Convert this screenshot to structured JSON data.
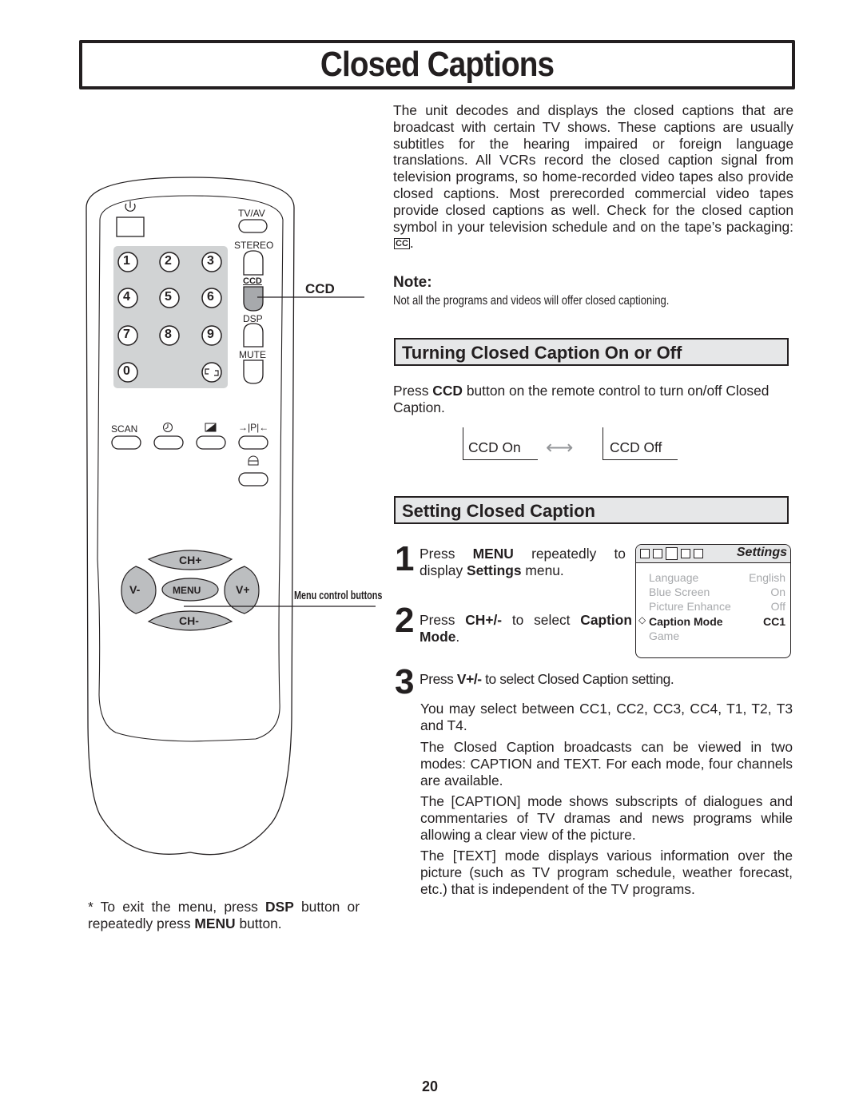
{
  "page": {
    "title": "Closed Captions",
    "page_number": "20"
  },
  "intro": {
    "text": "The unit decodes and displays the closed captions that are broadcast with certain TV shows. These captions are usually subtitles for the hearing impaired or foreign language translations. All VCRs record the closed caption signal from television programs, so home-recorded video tapes also provide closed captions. Most prerecorded commercial video tapes provide closed captions as well. Check for the closed caption symbol in your television schedule and on the tape’s packaging:",
    "cc_symbol": "CC",
    "end": "."
  },
  "note": {
    "heading": "Note:",
    "text": "Not all the programs and videos will offer closed captioning."
  },
  "section_on_off": {
    "heading": "Turning Closed Caption On or Off",
    "text_pre": "Press ",
    "text_bold": "CCD",
    "text_post": " button on the remote control to turn on/off Closed Caption.",
    "state_on": "CCD On",
    "state_off": "CCD Off",
    "arrow": "⟷"
  },
  "section_setting": {
    "heading": "Setting Closed Caption",
    "steps": [
      {
        "num": "1",
        "pre": "Press ",
        "b1": "MENU",
        "mid": " repeatedly to display ",
        "b2": "Settings",
        "post": " menu."
      },
      {
        "num": "2",
        "pre": "Press ",
        "b1": "CH+/-",
        "mid": " to select ",
        "b2": "Caption Mode",
        "post": "."
      },
      {
        "num": "3",
        "pre": "Press ",
        "b1": "V+/-",
        "post": " to select Closed Caption setting."
      }
    ],
    "paragraphs": [
      "You may select between CC1, CC2, CC3, CC4, T1, T2, T3 and T4.",
      "The Closed Caption broadcasts can be viewed in two modes: CAPTION and TEXT. For each mode, four channels are available.",
      "The [CAPTION] mode shows subscripts of dialogues and commentaries of TV dramas and news programs while allowing a clear view of the picture.",
      "The [TEXT] mode displays various information over the picture (such as TV program schedule, weather forecast, etc.) that is independent of the TV programs."
    ]
  },
  "osd_menu": {
    "title": "Settings",
    "items": [
      {
        "label": "Language",
        "value": "English",
        "selected": false
      },
      {
        "label": "Blue Screen",
        "value": "On",
        "selected": false
      },
      {
        "label": "Picture Enhance",
        "value": "Off",
        "selected": false
      },
      {
        "label": "Caption Mode",
        "value": "CC1",
        "selected": true
      },
      {
        "label": "Game",
        "value": "",
        "selected": false
      }
    ],
    "selector_glyph": "◇"
  },
  "remote": {
    "labels": {
      "tvav": "TV/AV",
      "stereo": "STEREO",
      "ccd": "CCD",
      "dsp": "DSP",
      "mute": "MUTE",
      "scan": "SCAN",
      "pp": "→|P|←",
      "ch_plus": "CH+",
      "ch_minus": "CH-",
      "v_minus": "V-",
      "v_plus": "V+",
      "menu": "MENU"
    },
    "digits": [
      "1",
      "2",
      "3",
      "4",
      "5",
      "6",
      "7",
      "8",
      "9",
      "0"
    ],
    "callout_ccd": "CCD",
    "callout_menu": "Menu control buttons"
  },
  "footnote": {
    "pre": "* To exit the menu, press ",
    "b1": "DSP",
    "mid": " button or repeatedly press ",
    "b2": "MENU",
    "post": " button."
  }
}
